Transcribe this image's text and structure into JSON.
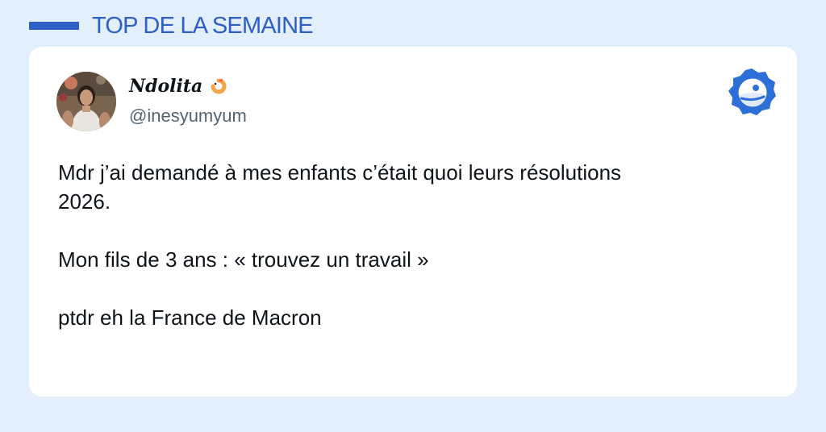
{
  "header": {
    "title": "TOP DE LA SEMAINE",
    "accent_color": "#2d5fc4"
  },
  "tweet": {
    "display_name": "Ndolita",
    "name_emoji": "shrimp-icon",
    "handle": "@inesyumyum",
    "lines": [
      "Mdr j’ai demandé à mes enfants c’était quoi leurs résolutions",
      "2026.",
      "",
      "Mon fils de 3 ans : « trouvez un travail »",
      "",
      "ptdr eh la France de Macron"
    ]
  },
  "brand": {
    "icon": "brand-logo-icon",
    "color": "#2d6fd6"
  }
}
